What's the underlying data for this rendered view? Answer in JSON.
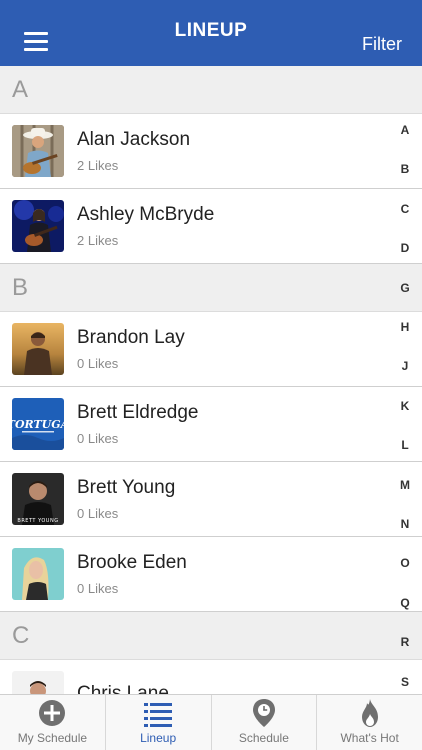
{
  "header": {
    "title": "LINEUP",
    "filter_label": "Filter",
    "menu_icon": "hamburger-menu-icon"
  },
  "sections": [
    {
      "letter": "A",
      "artists": [
        {
          "name": "Alan Jackson",
          "likes": "2 Likes"
        },
        {
          "name": "Ashley McBryde",
          "likes": "2 Likes"
        }
      ]
    },
    {
      "letter": "B",
      "artists": [
        {
          "name": "Brandon Lay",
          "likes": "0 Likes"
        },
        {
          "name": "Brett Eldredge",
          "likes": "0 Likes",
          "thumb_text": "TORTUGA"
        },
        {
          "name": "Brett Young",
          "likes": "0 Likes",
          "thumb_text": "BRETT YOUNG"
        },
        {
          "name": "Brooke Eden",
          "likes": "0 Likes"
        }
      ]
    },
    {
      "letter": "C",
      "artists": [
        {
          "name": "Chris Lane",
          "likes": ""
        }
      ]
    }
  ],
  "index_letters": [
    "A",
    "B",
    "C",
    "D",
    "G",
    "H",
    "J",
    "K",
    "L",
    "M",
    "N",
    "O",
    "Q",
    "R",
    "S"
  ],
  "tabs": [
    {
      "label": "My Schedule",
      "icon": "plus-circle-icon",
      "active": false
    },
    {
      "label": "Lineup",
      "icon": "list-icon",
      "active": true
    },
    {
      "label": "Schedule",
      "icon": "location-pin-icon",
      "active": false
    },
    {
      "label": "What's Hot",
      "icon": "flame-icon",
      "active": false
    }
  ],
  "colors": {
    "brand_blue": "#2e5db3",
    "section_bg": "#efefef",
    "tab_inactive": "#777777"
  }
}
